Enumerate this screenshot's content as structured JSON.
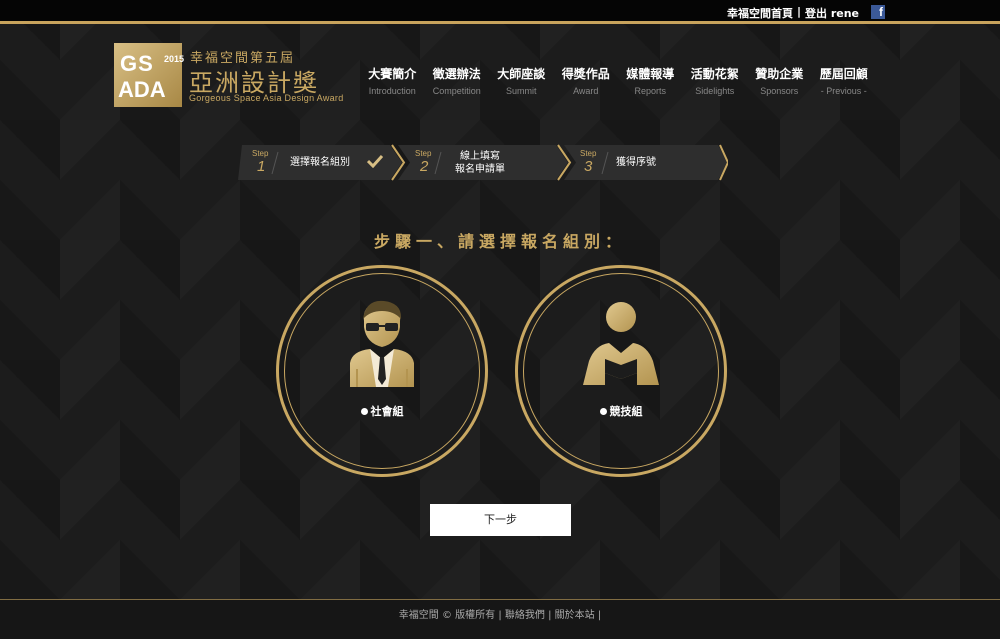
{
  "topbar": {
    "home_link": "幸福空間首頁",
    "separator": "|",
    "logout_label": "登出 rene",
    "facebook_icon": "f"
  },
  "logo": {
    "box_line1": "GS",
    "box_line2": "ADA",
    "year": "2015",
    "subtitle": "幸福空間第五屆",
    "title": "亞洲設計獎",
    "english": "Gorgeous Space Asia Design Award"
  },
  "nav": [
    {
      "zh": "大賽簡介",
      "en": "Introduction"
    },
    {
      "zh": "徵選辦法",
      "en": "Competition"
    },
    {
      "zh": "大師座談",
      "en": "Summit"
    },
    {
      "zh": "得獎作品",
      "en": "Award"
    },
    {
      "zh": "媒體報導",
      "en": "Reports"
    },
    {
      "zh": "活動花絮",
      "en": "Sidelights"
    },
    {
      "zh": "贊助企業",
      "en": "Sponsors"
    },
    {
      "zh": "歷屆回顧",
      "en": "- Previous -"
    }
  ],
  "steps": [
    {
      "label": "Step",
      "num": "1",
      "text": "選擇報名組別",
      "done": true
    },
    {
      "label": "Step",
      "num": "2",
      "text_line1": "線上填寫",
      "text_line2": "報名申請單"
    },
    {
      "label": "Step",
      "num": "3",
      "text": "獲得序號"
    }
  ],
  "heading": "步驟一、請選擇報名組別：",
  "options": [
    {
      "label": "社會組",
      "icon": "professional-person-icon"
    },
    {
      "label": "競技組",
      "icon": "student-reading-icon"
    }
  ],
  "next_button": "下一步",
  "footer": {
    "brand": "幸福空間 © 版權所有",
    "sep": " | ",
    "contact": "聯絡我們",
    "about": "關於本站",
    "trail": " |"
  },
  "colors": {
    "gold": "#c9a862",
    "background": "#1c1c1c",
    "facebook": "#3b5998"
  }
}
